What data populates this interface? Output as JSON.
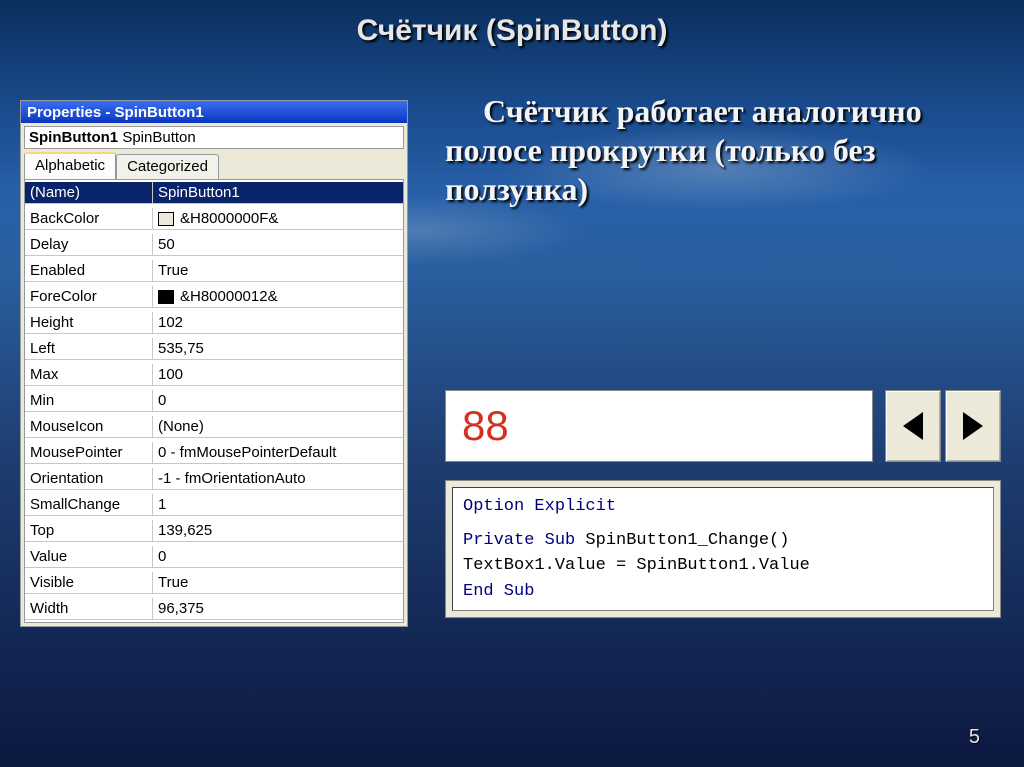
{
  "slide": {
    "title": "Счётчик (SpinButton)",
    "body": "Счётчик работает аналогично полосе прокрутки (только без ползунка)",
    "page_number": "5"
  },
  "properties_window": {
    "titlebar": "Properties - SpinButton1",
    "object_name": "SpinButton1",
    "object_type": "SpinButton",
    "tabs": {
      "alphabetic": "Alphabetic",
      "categorized": "Categorized"
    },
    "rows": [
      {
        "name": "(Name)",
        "value": "SpinButton1",
        "selected": true
      },
      {
        "name": "BackColor",
        "value": "&H8000000F&",
        "swatch": "light"
      },
      {
        "name": "Delay",
        "value": "50"
      },
      {
        "name": "Enabled",
        "value": "True"
      },
      {
        "name": "ForeColor",
        "value": "&H80000012&",
        "swatch": "dark"
      },
      {
        "name": "Height",
        "value": "102"
      },
      {
        "name": "Left",
        "value": "535,75"
      },
      {
        "name": "Max",
        "value": "100"
      },
      {
        "name": "Min",
        "value": "0"
      },
      {
        "name": "MouseIcon",
        "value": "(None)"
      },
      {
        "name": "MousePointer",
        "value": "0 - fmMousePointerDefault"
      },
      {
        "name": "Orientation",
        "value": "-1 - fmOrientationAuto"
      },
      {
        "name": "SmallChange",
        "value": "1"
      },
      {
        "name": "Top",
        "value": "139,625"
      },
      {
        "name": "Value",
        "value": "0"
      },
      {
        "name": "Visible",
        "value": "True"
      },
      {
        "name": "Width",
        "value": "96,375"
      }
    ]
  },
  "spin_demo": {
    "value": "88"
  },
  "code": {
    "line1a": "Option Explicit",
    "line2a": "Private Sub",
    "line2b": " SpinButton1_Change()",
    "line3": "TextBox1.Value = SpinButton1.Value",
    "line4": "End Sub"
  }
}
